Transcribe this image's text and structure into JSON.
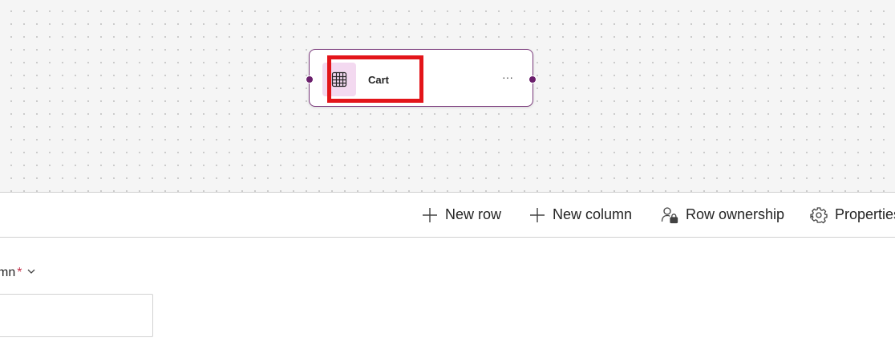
{
  "canvas": {
    "node": {
      "title": "Cart",
      "icon": "table-grid-icon",
      "more_label": "···",
      "accent_color": "#7b3a7c",
      "icon_bg_color": "#f3d9f0"
    },
    "highlight_color": "#e3151a"
  },
  "toolbar": {
    "items": [
      {
        "label": "New row",
        "icon": "plus-icon"
      },
      {
        "label": "New column",
        "icon": "plus-icon"
      },
      {
        "label": "Row ownership",
        "icon": "person-lock-icon"
      },
      {
        "label": "Properties",
        "icon": "gear-icon"
      }
    ]
  },
  "form": {
    "field_label": "mn",
    "required_mark": "*",
    "input_value": ""
  }
}
